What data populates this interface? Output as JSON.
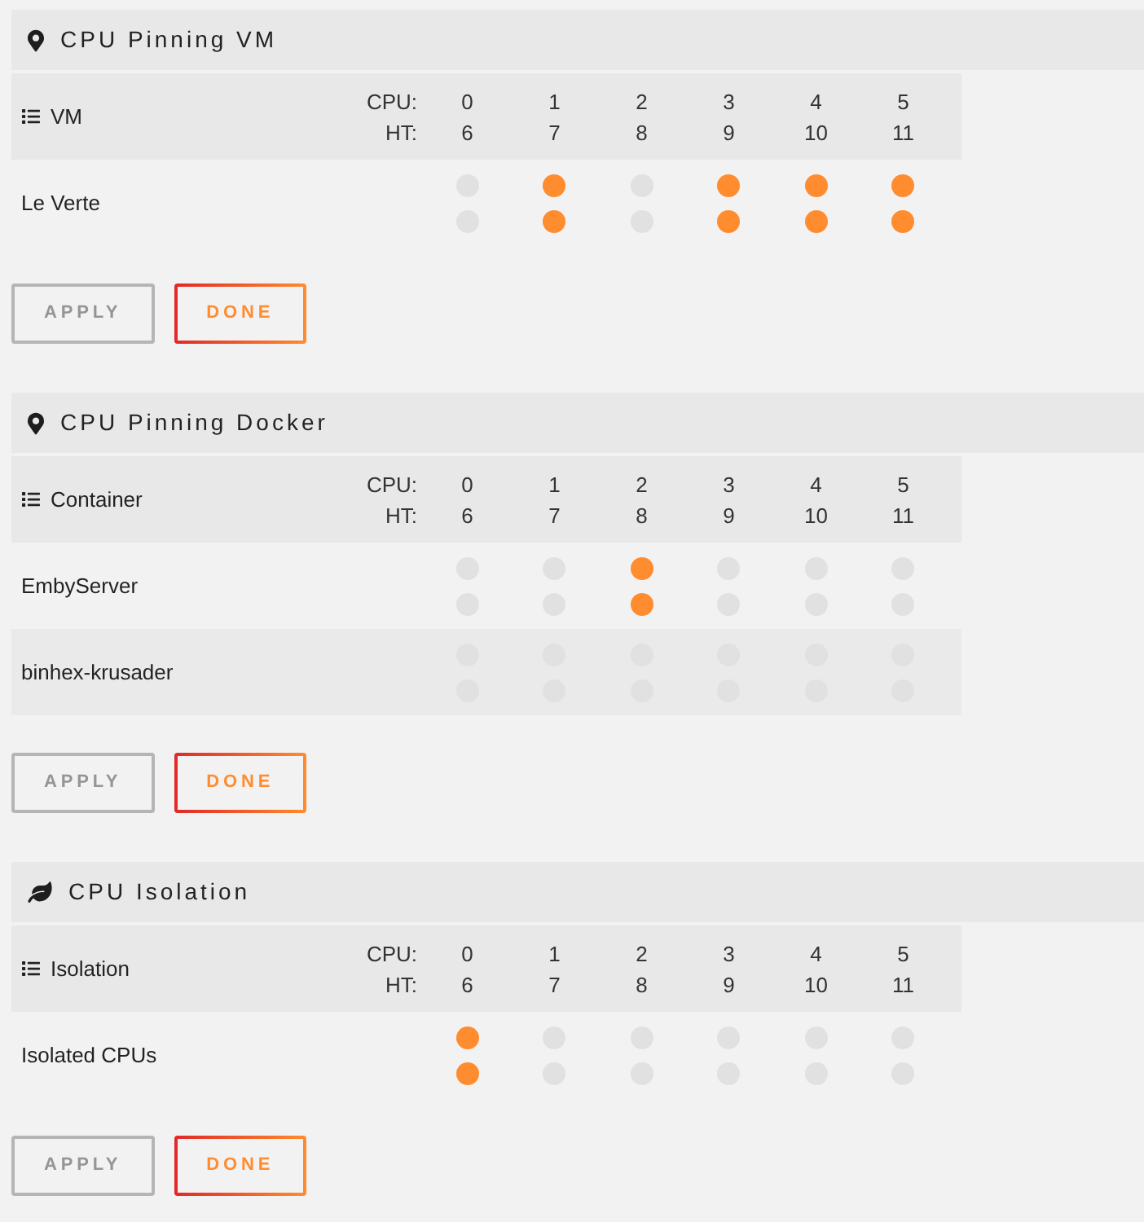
{
  "sections": [
    {
      "kind": "pinning",
      "title": "CPU Pinning VM",
      "table": {
        "heading": "VM",
        "cpu_label": "CPU:",
        "ht_label": "HT:",
        "cores": [
          {
            "cpu": "0",
            "ht": "6"
          },
          {
            "cpu": "1",
            "ht": "7"
          },
          {
            "cpu": "2",
            "ht": "8"
          },
          {
            "cpu": "3",
            "ht": "9"
          },
          {
            "cpu": "4",
            "ht": "10"
          },
          {
            "cpu": "5",
            "ht": "11"
          }
        ],
        "rows": [
          {
            "name": "Le Verte",
            "cores": [
              {
                "cpu_checked": false,
                "ht_checked": false
              },
              {
                "cpu_checked": true,
                "ht_checked": true
              },
              {
                "cpu_checked": false,
                "ht_checked": false
              },
              {
                "cpu_checked": true,
                "ht_checked": true
              },
              {
                "cpu_checked": true,
                "ht_checked": true
              },
              {
                "cpu_checked": true,
                "ht_checked": true
              }
            ]
          }
        ]
      },
      "buttons": [
        {
          "label": "APPLY",
          "disabled": true
        },
        {
          "label": "DONE",
          "disabled": false
        }
      ]
    },
    {
      "kind": "pinning",
      "title": "CPU Pinning Docker",
      "table": {
        "heading": "Container",
        "cpu_label": "CPU:",
        "ht_label": "HT:",
        "cores": [
          {
            "cpu": "0",
            "ht": "6"
          },
          {
            "cpu": "1",
            "ht": "7"
          },
          {
            "cpu": "2",
            "ht": "8"
          },
          {
            "cpu": "3",
            "ht": "9"
          },
          {
            "cpu": "4",
            "ht": "10"
          },
          {
            "cpu": "5",
            "ht": "11"
          }
        ],
        "rows": [
          {
            "name": "EmbyServer",
            "cores": [
              {
                "cpu_checked": false,
                "ht_checked": false
              },
              {
                "cpu_checked": false,
                "ht_checked": false
              },
              {
                "cpu_checked": true,
                "ht_checked": true
              },
              {
                "cpu_checked": false,
                "ht_checked": false
              },
              {
                "cpu_checked": false,
                "ht_checked": false
              },
              {
                "cpu_checked": false,
                "ht_checked": false
              }
            ]
          },
          {
            "name": "binhex-krusader",
            "cores": [
              {
                "cpu_checked": false,
                "ht_checked": false
              },
              {
                "cpu_checked": false,
                "ht_checked": false
              },
              {
                "cpu_checked": false,
                "ht_checked": false
              },
              {
                "cpu_checked": false,
                "ht_checked": false
              },
              {
                "cpu_checked": false,
                "ht_checked": false
              },
              {
                "cpu_checked": false,
                "ht_checked": false
              }
            ]
          }
        ]
      },
      "buttons": [
        {
          "label": "APPLY",
          "disabled": true
        },
        {
          "label": "DONE",
          "disabled": false
        }
      ]
    },
    {
      "kind": "isolation",
      "title": "CPU Isolation",
      "table": {
        "heading": "Isolation",
        "cpu_label": "CPU:",
        "ht_label": "HT:",
        "cores": [
          {
            "cpu": "0",
            "ht": "6"
          },
          {
            "cpu": "1",
            "ht": "7"
          },
          {
            "cpu": "2",
            "ht": "8"
          },
          {
            "cpu": "3",
            "ht": "9"
          },
          {
            "cpu": "4",
            "ht": "10"
          },
          {
            "cpu": "5",
            "ht": "11"
          }
        ],
        "rows": [
          {
            "name": "Isolated CPUs",
            "cores": [
              {
                "cpu_checked": true,
                "ht_checked": true
              },
              {
                "cpu_checked": false,
                "ht_checked": false
              },
              {
                "cpu_checked": false,
                "ht_checked": false
              },
              {
                "cpu_checked": false,
                "ht_checked": false
              },
              {
                "cpu_checked": false,
                "ht_checked": false
              },
              {
                "cpu_checked": false,
                "ht_checked": false
              }
            ]
          }
        ]
      },
      "buttons": [
        {
          "label": "APPLY",
          "disabled": true
        },
        {
          "label": "DONE",
          "disabled": false
        }
      ]
    }
  ]
}
